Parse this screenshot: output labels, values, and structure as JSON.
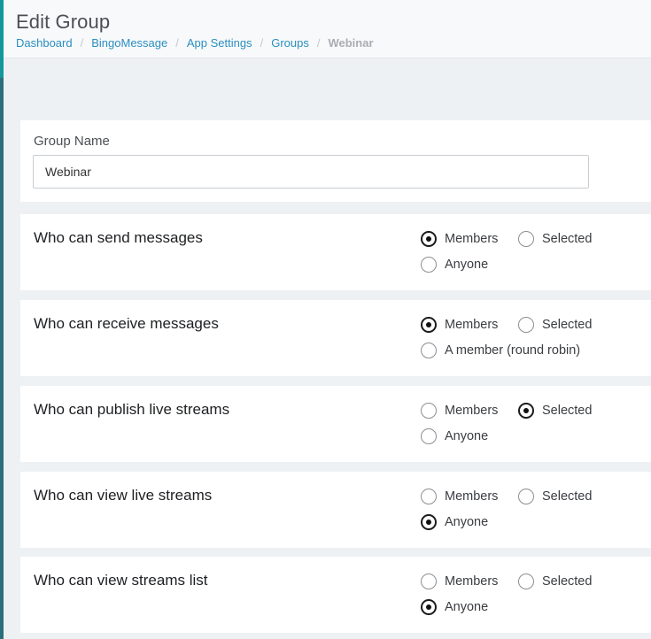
{
  "header": {
    "title": "Edit Group",
    "breadcrumb": [
      "Dashboard",
      "BingoMessage",
      "App Settings",
      "Groups",
      "Webinar"
    ]
  },
  "group_name": {
    "label": "Group Name",
    "value": "Webinar"
  },
  "settings": [
    {
      "label": "Who can send messages",
      "options": [
        {
          "label": "Members",
          "checked": true
        },
        {
          "label": "Selected",
          "checked": false
        },
        {
          "label": "Anyone",
          "checked": false
        }
      ]
    },
    {
      "label": "Who can receive messages",
      "options": [
        {
          "label": "Members",
          "checked": true
        },
        {
          "label": "Selected",
          "checked": false
        },
        {
          "label": "A member (round robin)",
          "checked": false
        }
      ]
    },
    {
      "label": "Who can publish live streams",
      "options": [
        {
          "label": "Members",
          "checked": false
        },
        {
          "label": "Selected",
          "checked": true
        },
        {
          "label": "Anyone",
          "checked": false
        }
      ]
    },
    {
      "label": "Who can view live streams",
      "options": [
        {
          "label": "Members",
          "checked": false
        },
        {
          "label": "Selected",
          "checked": false
        },
        {
          "label": "Anyone",
          "checked": true
        }
      ]
    },
    {
      "label": "Who can view streams list",
      "options": [
        {
          "label": "Members",
          "checked": false
        },
        {
          "label": "Selected",
          "checked": false
        },
        {
          "label": "Anyone",
          "checked": true
        }
      ]
    }
  ],
  "colors": {
    "accent": "#12979a",
    "link": "#2a8fc0",
    "background": "#eef1f3"
  }
}
